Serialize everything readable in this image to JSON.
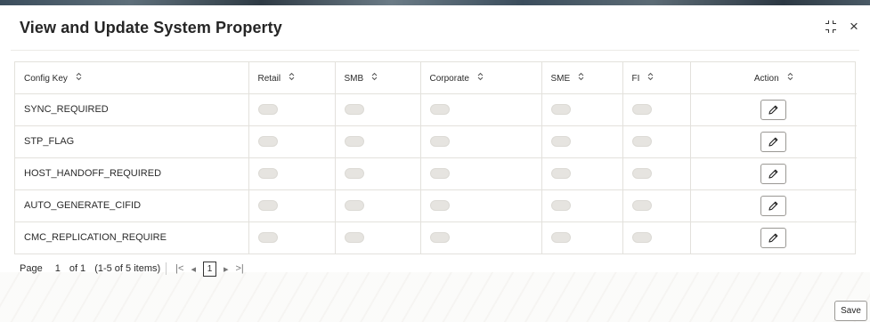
{
  "dialog": {
    "title": "View and Update System Property",
    "close_symbol": "×"
  },
  "table": {
    "columns": [
      "Config Key",
      "Retail",
      "SMB",
      "Corporate",
      "SME",
      "FI",
      "Action"
    ],
    "sort_glyph": "⌃⌄",
    "rows": [
      {
        "config_key": "SYNC_REQUIRED",
        "retail": false,
        "smb": false,
        "corporate": false,
        "sme": false,
        "fi": false
      },
      {
        "config_key": "STP_FLAG",
        "retail": false,
        "smb": false,
        "corporate": false,
        "sme": false,
        "fi": false
      },
      {
        "config_key": "HOST_HANDOFF_REQUIRED",
        "retail": false,
        "smb": false,
        "corporate": false,
        "sme": false,
        "fi": false
      },
      {
        "config_key": "AUTO_GENERATE_CIFID",
        "retail": false,
        "smb": false,
        "corporate": false,
        "sme": false,
        "fi": false
      },
      {
        "config_key": "CMC_REPLICATION_REQUIRE",
        "retail": false,
        "smb": false,
        "corporate": false,
        "sme": false,
        "fi": false
      }
    ]
  },
  "pagination": {
    "page_label": "Page",
    "page_number": "1",
    "of_label": "of 1",
    "items_label": "(1-5 of 5 items)",
    "current_page": "1",
    "first_glyph": "|<",
    "prev_glyph": "◂",
    "next_glyph": "▸",
    "last_glyph": ">|"
  },
  "footer": {
    "save_label": "Save"
  },
  "icons": {
    "collapse": "collapse-icon",
    "close": "close-icon",
    "edit": "pencil-icon",
    "sort": "sort-icon"
  },
  "colors": {
    "toggle_off": "#e6e4e0",
    "border": "#e3e1dc"
  }
}
